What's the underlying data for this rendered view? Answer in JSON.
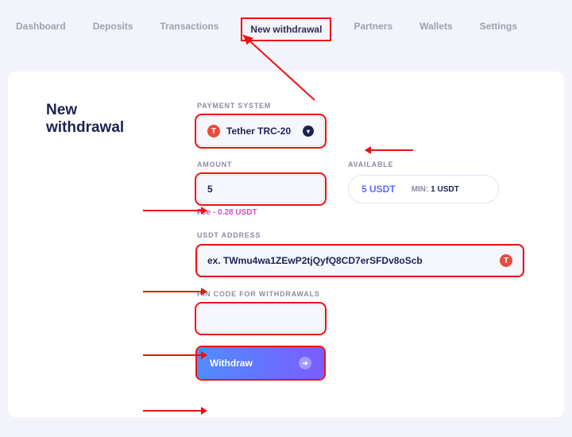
{
  "nav": {
    "items": [
      {
        "label": "Dashboard"
      },
      {
        "label": "Deposits"
      },
      {
        "label": "Transactions"
      },
      {
        "label": "New withdrawal"
      },
      {
        "label": "Partners"
      },
      {
        "label": "Wallets"
      },
      {
        "label": "Settings"
      }
    ],
    "active_index": 3
  },
  "page": {
    "title": "New withdrawal"
  },
  "form": {
    "payment_system": {
      "label": "PAYMENT SYSTEM",
      "selected": "Tether TRC-20",
      "badge_letter": "T"
    },
    "amount": {
      "label": "AMOUNT",
      "value": "5",
      "fee_text": "Fee - 0.28 USDT"
    },
    "available": {
      "label": "AVAILABLE",
      "amount": "5 USDT",
      "min_label": "MIN:",
      "min_value": "1 USDT"
    },
    "address": {
      "label": "USDT ADDRESS",
      "placeholder": "ex. TWmu4wa1ZEwP2tjQyfQ8CD7erSFDv8oScb",
      "badge_letter": "T"
    },
    "pin": {
      "label": "PIN CODE FOR WITHDRAWALS",
      "value": ""
    },
    "submit_label": "Withdraw"
  }
}
